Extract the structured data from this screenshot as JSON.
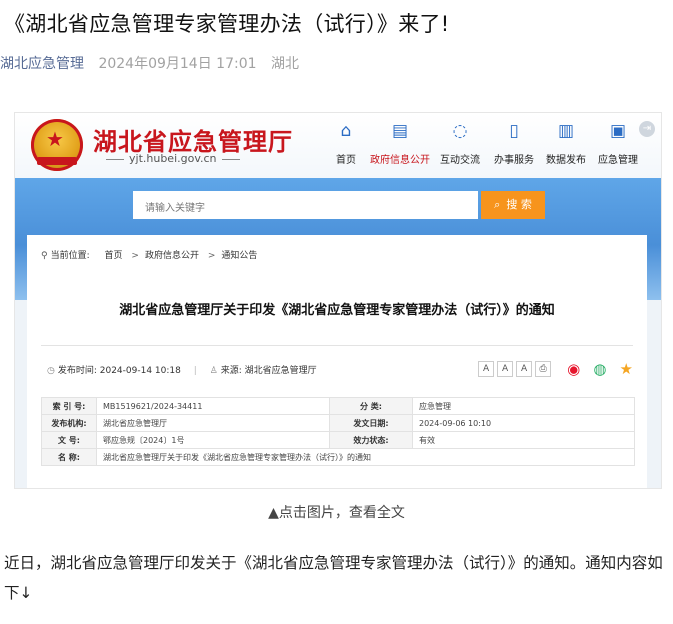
{
  "article": {
    "title": "《湖北省应急管理专家管理办法（试行）》来了!",
    "account": "湖北应急管理",
    "date": "2024年09月14日 17:01",
    "region": "湖北"
  },
  "site": {
    "name": "湖北省应急管理厅",
    "url": "yjt.hubei.gov.cn",
    "nav": [
      {
        "label": "首页",
        "icon": "home-icon"
      },
      {
        "label": "政府信息公开",
        "icon": "document-icon"
      },
      {
        "label": "互动交流",
        "icon": "chat-icon"
      },
      {
        "label": "办事服务",
        "icon": "bookmark-icon"
      },
      {
        "label": "数据发布",
        "icon": "bar-chart-icon"
      },
      {
        "label": "应急管理",
        "icon": "files-icon"
      }
    ],
    "search_placeholder": "请输入关键字",
    "search_button": "搜 索",
    "brand_color": "#c8161d",
    "accent_color": "#f7941d"
  },
  "page": {
    "breadcrumb_label": "当前位置:",
    "breadcrumb": [
      "首页",
      "政府信息公开",
      "通知公告"
    ],
    "doc_title": "湖北省应急管理厅关于印发《湖北省应急管理专家管理办法（试行）》的通知",
    "publish_time": "发布时间: 2024-09-14 10:18",
    "source": "来源: 湖北省应急管理厅",
    "font_sizes": [
      "A",
      "A",
      "A"
    ],
    "info": {
      "index_key": "索 引 号:",
      "index_val": "MB1519621/2024-34411",
      "category_key": "分 类:",
      "category_val": "应急管理",
      "issuer_key": "发布机构:",
      "issuer_val": "湖北省应急管理厅",
      "issue_date_key": "发文日期:",
      "issue_date_val": "2024-09-06 10:10",
      "docno_key": "文 号:",
      "docno_val": "鄂应急规〔2024〕1号",
      "status_key": "效力状态:",
      "status_val": "有效",
      "name_key": "名 称:",
      "name_val": "湖北省应急管理厅关于印发《湖北省应急管理专家管理办法（试行）》的通知"
    }
  },
  "caption": "▲点击图片，查看全文",
  "body": "近日，湖北省应急管理厅印发关于《湖北省应急管理专家管理办法（试行）》的通知。通知内容如下↓"
}
